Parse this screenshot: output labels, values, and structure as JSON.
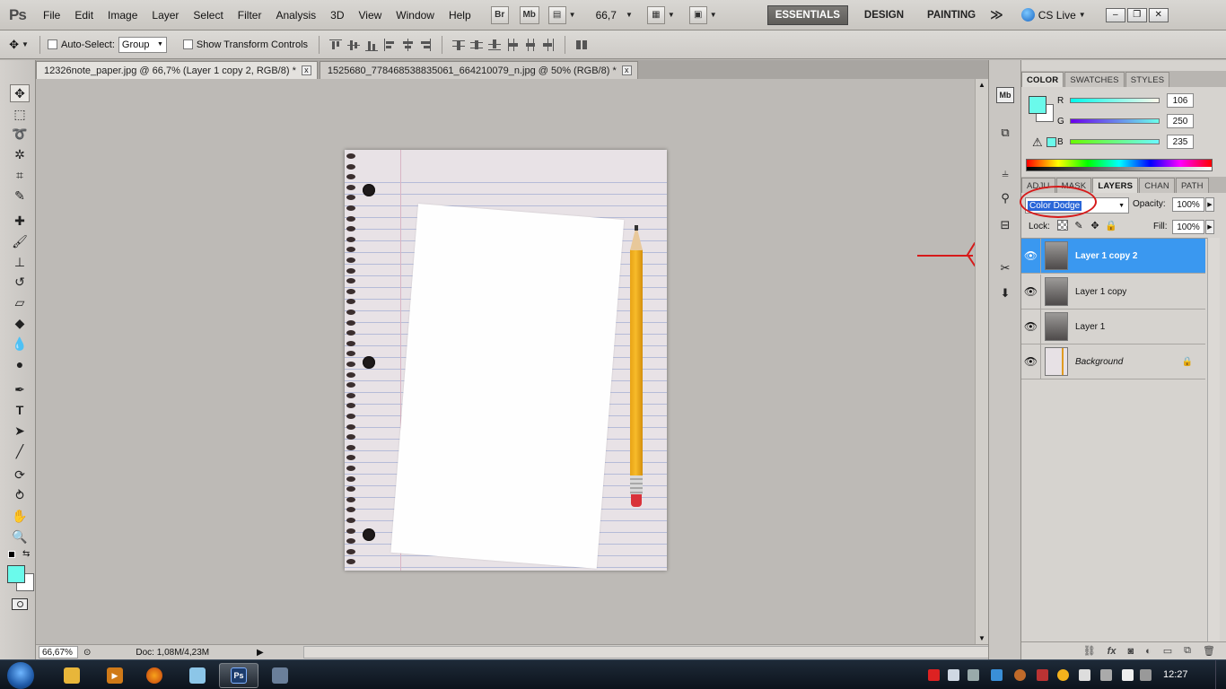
{
  "app": {
    "logo": "Ps"
  },
  "menu": [
    "File",
    "Edit",
    "Image",
    "Layer",
    "Select",
    "Filter",
    "Analysis",
    "3D",
    "View",
    "Window",
    "Help"
  ],
  "appbar": {
    "bridge_label": "Br",
    "minibridge_label": "Mb",
    "zoom": "66,7",
    "workspaces": [
      "ESSENTIALS",
      "DESIGN",
      "PAINTING"
    ],
    "more_workspaces": "≫",
    "cs_live": "CS Live"
  },
  "options": {
    "auto_select_label": "Auto-Select:",
    "auto_select_value": "Group",
    "show_transform_label": "Show Transform Controls"
  },
  "doc_tabs": [
    {
      "label": "12326note_paper.jpg @ 66,7% (Layer 1 copy 2, RGB/8) *",
      "active": true
    },
    {
      "label": "1525680_778468538835061_664210079_n.jpg @ 50% (RGB/8) *",
      "active": false
    }
  ],
  "tab_close": "x",
  "status": {
    "zoom": "66,67%",
    "doc": "Doc: 1,08M/4,23M"
  },
  "colors": {
    "foreground": "#6afaeb",
    "accent": "#3a98f0",
    "annotation": "#d61a1a"
  },
  "color_panel": {
    "tabs": [
      "COLOR",
      "SWATCHES",
      "STYLES"
    ],
    "channels": [
      {
        "label": "R",
        "value": "106"
      },
      {
        "label": "G",
        "value": "250"
      },
      {
        "label": "B",
        "value": "235"
      }
    ]
  },
  "layers_panel": {
    "tabs": [
      "ADJU",
      "MASK",
      "LAYERS",
      "CHAN",
      "PATH"
    ],
    "blend_mode": "Color Dodge",
    "opacity_label": "Opacity:",
    "opacity_value": "100%",
    "lock_label": "Lock:",
    "fill_label": "Fill:",
    "fill_value": "100%",
    "layers": [
      {
        "name": "Layer 1 copy 2",
        "selected": true
      },
      {
        "name": "Layer 1 copy",
        "selected": false
      },
      {
        "name": "Layer 1",
        "selected": false
      },
      {
        "name": "Background",
        "selected": false,
        "locked": true
      }
    ]
  },
  "taskbar": {
    "time": "12:27"
  }
}
